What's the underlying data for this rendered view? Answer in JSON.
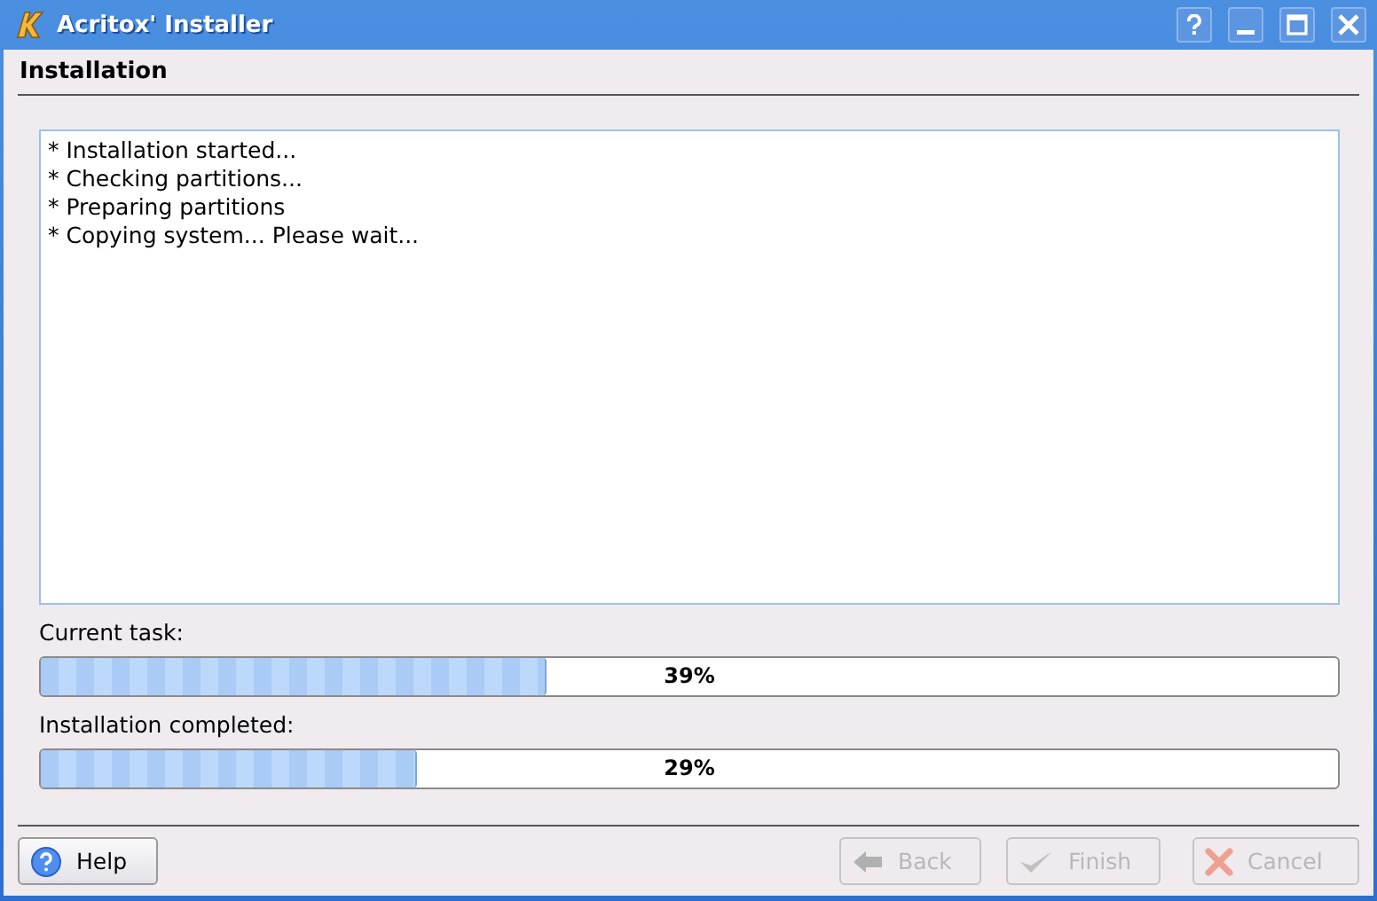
{
  "window": {
    "title": "Acritox' Installer"
  },
  "page": {
    "title": "Installation"
  },
  "log": [
    "* Installation started...",
    "* Checking partitions...",
    "* Preparing partitions",
    "* Copying system... Please wait..."
  ],
  "progress": [
    {
      "label": "Current task:",
      "level": 0.39,
      "reading": "39%"
    },
    {
      "label": "Installation completed:",
      "level": 0.29,
      "reading": "29%"
    }
  ],
  "buttons": [
    {
      "kind": "help",
      "label": "Help",
      "disabled": false
    },
    {
      "kind": "back",
      "label": "Back",
      "disabled": true
    },
    {
      "kind": "finish",
      "label": "Finish",
      "disabled": true
    },
    {
      "kind": "cancel",
      "label": "Cancel",
      "disabled": true
    }
  ]
}
